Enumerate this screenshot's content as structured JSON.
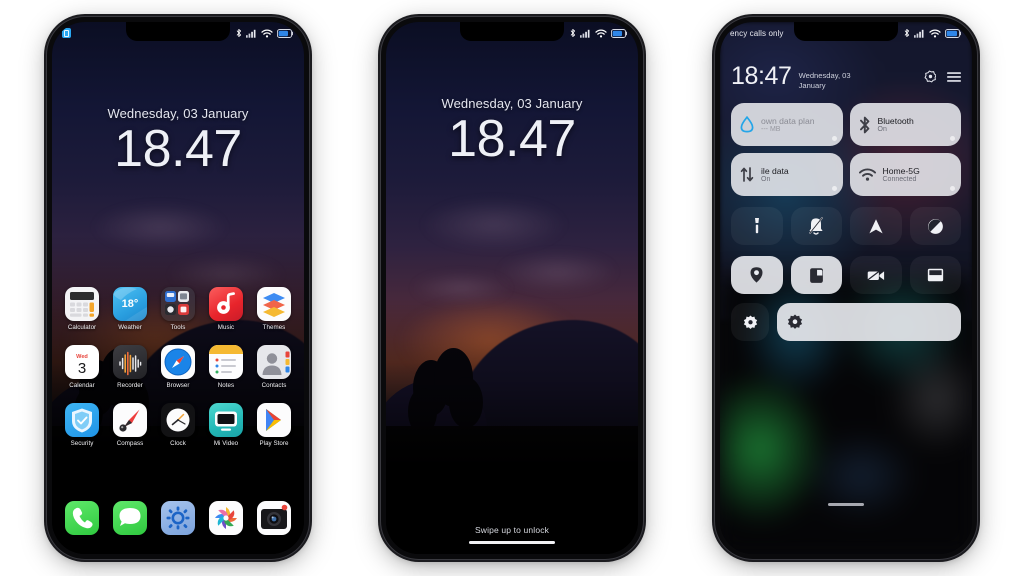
{
  "meta": {
    "scene": "Three smartphone mockups showing MIUI iOS-style theme: home screen, lock screen, and control center",
    "background_color": "#ffffff"
  },
  "common": {
    "date": "Wednesday, 03 January",
    "time": "18.47",
    "time_colon": "18:47",
    "status_icons": [
      "bluetooth-icon",
      "signal-icon",
      "wifi-icon",
      "battery-icon"
    ]
  },
  "phone_home": {
    "name": "Home screen",
    "statusbar": {
      "notification_badge": "notification-badge-icon",
      "bluetooth": "bluetooth-icon",
      "signal": "signal-icon",
      "wifi": "wifi-icon",
      "battery": "battery-icon"
    },
    "clock": {
      "date": "Wednesday, 03 January",
      "time": "18.47"
    },
    "app_rows": [
      [
        {
          "label": "Calculator",
          "icon": "calculator-icon"
        },
        {
          "label": "Weather",
          "icon": "weather-icon",
          "value": "18°"
        },
        {
          "label": "Tools",
          "icon": "tools-folder-icon"
        },
        {
          "label": "Music",
          "icon": "music-icon"
        },
        {
          "label": "Themes",
          "icon": "themes-icon"
        }
      ],
      [
        {
          "label": "Calendar",
          "icon": "calendar-icon",
          "weekday": "Wed",
          "day": "3"
        },
        {
          "label": "Recorder",
          "icon": "recorder-icon"
        },
        {
          "label": "Browser",
          "icon": "browser-compass-icon"
        },
        {
          "label": "Notes",
          "icon": "notes-icon"
        },
        {
          "label": "Contacts",
          "icon": "contacts-icon"
        }
      ],
      [
        {
          "label": "Security",
          "icon": "security-shield-icon"
        },
        {
          "label": "Compass",
          "icon": "compass-icon"
        },
        {
          "label": "Clock",
          "icon": "clock-icon"
        },
        {
          "label": "Mi Video",
          "icon": "mi-video-icon"
        },
        {
          "label": "Play Store",
          "icon": "play-store-icon"
        }
      ]
    ],
    "dock": [
      {
        "label": "Phone",
        "icon": "phone-icon"
      },
      {
        "label": "Messages",
        "icon": "messages-icon"
      },
      {
        "label": "Settings",
        "icon": "settings-gear-icon"
      },
      {
        "label": "Photos",
        "icon": "photos-icon"
      },
      {
        "label": "Camera",
        "icon": "camera-icon"
      }
    ]
  },
  "phone_lock": {
    "name": "Lock screen",
    "clock": {
      "date": "Wednesday, 03 January",
      "time": "18.47"
    },
    "unlock_hint": "Swipe up to unlock"
  },
  "phone_control": {
    "name": "Control center",
    "statusbar": {
      "carrier_text": "ency calls only",
      "carrier_text_full": "Emergency calls only",
      "bluetooth": "bluetooth-icon",
      "signal": "signal-icon",
      "wifi": "wifi-icon",
      "battery": "battery-icon"
    },
    "header": {
      "time": "18:47",
      "date": "Wednesday, 03 January",
      "settings_icon": "settings-gear-icon",
      "menu_icon": "hamburger-menu-icon"
    },
    "tiles": [
      {
        "title": "own data plan",
        "title_full": "Unknown data plan",
        "subtitle": "--- MB",
        "icon": "data-drop-icon",
        "state": "dim"
      },
      {
        "title": "Bluetooth",
        "subtitle": "On",
        "icon": "bluetooth-icon",
        "state": "on"
      },
      {
        "title": "ile data",
        "title_full": "Mobile data",
        "subtitle": "On",
        "icon": "mobile-data-icon",
        "state": "on"
      },
      {
        "title": "Home-5G",
        "subtitle": "Connected",
        "icon": "wifi-icon",
        "state": "on"
      }
    ],
    "toggles_row1": [
      {
        "name": "flashlight-icon",
        "state": "off"
      },
      {
        "name": "silent-bell-icon",
        "state": "off"
      },
      {
        "name": "navigation-arrow-icon",
        "state": "off"
      },
      {
        "name": "do-not-disturb-icon",
        "state": "off"
      }
    ],
    "toggles_row2": [
      {
        "name": "location-pin-icon",
        "state": "on"
      },
      {
        "name": "reading-mode-icon",
        "state": "on"
      },
      {
        "name": "screen-record-icon",
        "state": "off"
      },
      {
        "name": "split-screen-icon",
        "state": "off"
      }
    ],
    "bottom": {
      "toggle": {
        "name": "auto-brightness-icon",
        "state": "off"
      },
      "slider": {
        "name": "brightness-slider",
        "icon": "brightness-sun-icon",
        "value": 100
      }
    }
  }
}
